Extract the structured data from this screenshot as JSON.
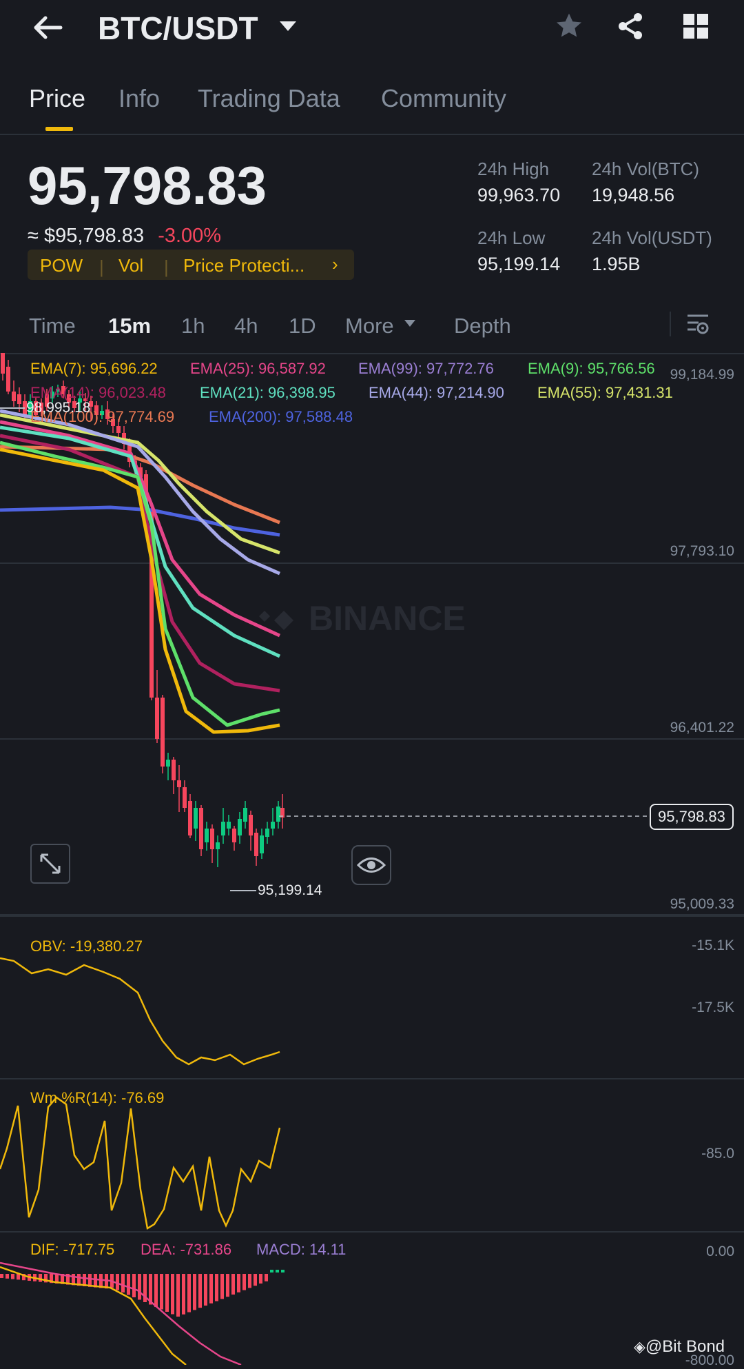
{
  "header": {
    "pair": "BTC/USDT",
    "tabs": [
      "Price",
      "Info",
      "Trading Data",
      "Community"
    ],
    "active_tab": 0
  },
  "price": {
    "last": "95,798.83",
    "approx": "≈ $95,798.83",
    "change": "-3.00%",
    "tags": [
      "POW",
      "Vol",
      "Price Protecti..."
    ]
  },
  "stats": {
    "high_label": "24h High",
    "high": "99,963.70",
    "low_label": "24h Low",
    "low": "95,199.14",
    "vol_btc_label": "24h Vol(BTC)",
    "vol_btc": "19,948.56",
    "vol_usdt_label": "24h Vol(USDT)",
    "vol_usdt": "1.95B"
  },
  "timeframes": [
    "Time",
    "15m",
    "1h",
    "4h",
    "1D",
    "More",
    "Depth"
  ],
  "active_timeframe": 1,
  "ema": [
    {
      "label": "EMA(7): 95,696.22",
      "color": "#f0b90b"
    },
    {
      "label": "EMA(25): 96,587.92",
      "color": "#e6468a"
    },
    {
      "label": "EMA(99): 97,772.76",
      "color": "#9b7fd4"
    },
    {
      "label": "EMA(9): 95,766.56",
      "color": "#5ee06a"
    },
    {
      "label": "EMA(14): 96,023.48",
      "color": "#b0215f"
    },
    {
      "label": "EMA(21): 96,398.95",
      "color": "#5fe0c0"
    },
    {
      "label": "EMA(44): 97,214.90",
      "color": "#a7a9e8"
    },
    {
      "label": "EMA(55): 97,431.31",
      "color": "#d6e46a"
    },
    {
      "label": "EMA(100): 97,774.69",
      "color": "#e87852"
    },
    {
      "label": "EMA(200): 97,588.48",
      "color": "#4e63e0"
    }
  ],
  "chart_axis": {
    "price_ticks": [
      "99,184.99",
      "97,793.10",
      "96,401.22",
      "95,009.33"
    ],
    "high_marker": "98,995.18",
    "low_marker": "95,199.14",
    "current_price_tag": "95,798.83",
    "watermark": "BINANCE"
  },
  "obv": {
    "label": "OBV: -19,380.27",
    "ticks": [
      "-15.1K",
      "-17.5K"
    ],
    "color": "#f0b90b"
  },
  "wmr": {
    "label": "Wm %R(14): -76.69",
    "ticks": [
      "-85.0"
    ],
    "color": "#f0b90b"
  },
  "macd": {
    "dif": "DIF: -717.75",
    "dea": "DEA: -731.86",
    "macd": "MACD: 14.11",
    "ticks": [
      "0.00",
      "-800.00"
    ],
    "dif_color": "#f0b90b",
    "dea_color": "#e6468a",
    "macd_color": "#9b7fd4"
  },
  "watermark_credit": "@Bit Bond",
  "colors": {
    "up": "#0ecb81",
    "down": "#f6465d",
    "accent": "#f0b90b",
    "bg": "#181a20"
  }
}
